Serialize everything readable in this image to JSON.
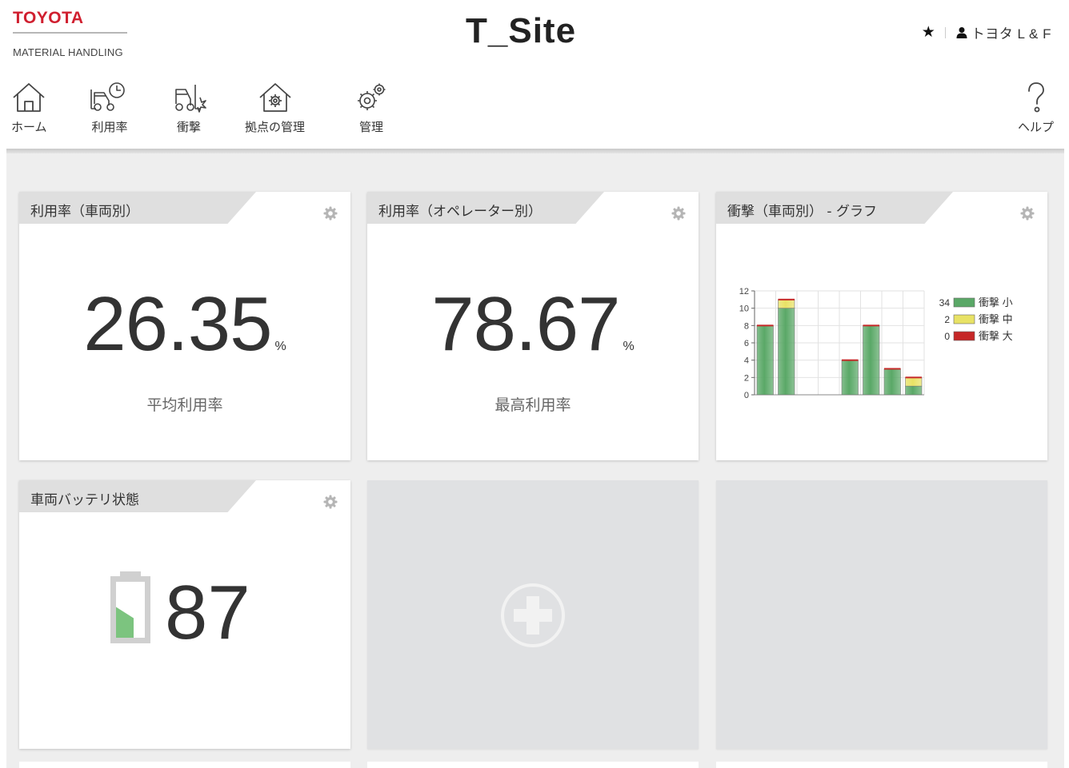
{
  "brand": {
    "name": "TOYOTA",
    "sub": "MATERIAL HANDLING"
  },
  "site": {
    "title": "T_Site"
  },
  "user": {
    "favorite_icon": "star-icon",
    "name": "トヨタ L & F"
  },
  "nav": {
    "home": "ホーム",
    "utilization": "利用率",
    "impact": "衝撃",
    "site_management": "拠点の管理",
    "management": "管理",
    "help": "ヘルプ"
  },
  "cards": {
    "util_vehicle": {
      "title": "利用率（車両別）",
      "value": "26.35",
      "unit": "%",
      "caption": "平均利用率"
    },
    "util_operator": {
      "title": "利用率（オペレーター別）",
      "value": "78.67",
      "unit": "%",
      "caption": "最高利用率"
    },
    "impact_graph": {
      "title": "衝撃（車両別） - グラフ"
    },
    "battery": {
      "title": "車両バッテリ状態",
      "value": "87",
      "fill_fraction": 0.55
    }
  },
  "colors": {
    "brand_red": "#d01f2f",
    "small": "#5aa867",
    "medium": "#e8e265",
    "large": "#c62828",
    "battery_fill": "#7cc47f"
  },
  "chart_data": {
    "type": "bar",
    "stacked": true,
    "categories": [
      "",
      "",
      "",
      "",
      "",
      "",
      "",
      ""
    ],
    "series": [
      {
        "name": "衝撃 小",
        "total": "34",
        "values": [
          8,
          10,
          0,
          0,
          4,
          8,
          3,
          1
        ]
      },
      {
        "name": "衝撃 中",
        "total": "2",
        "values": [
          0,
          1,
          0,
          0,
          0,
          0,
          0,
          1
        ]
      },
      {
        "name": "衝撃 大",
        "total": "0",
        "values": [
          0,
          0,
          0,
          0,
          0,
          0,
          0,
          0
        ]
      }
    ],
    "yticks": [
      "0",
      "2",
      "4",
      "6",
      "8",
      "10",
      "12"
    ],
    "ylim": [
      0,
      12
    ],
    "grid": true,
    "legend_position": "right"
  }
}
